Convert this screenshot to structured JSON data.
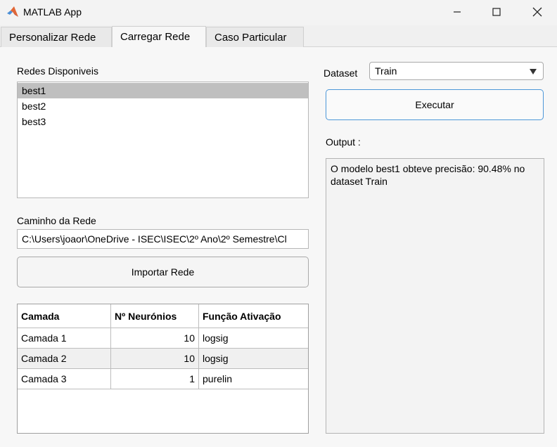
{
  "window": {
    "title": "MATLAB App"
  },
  "tabs": [
    {
      "label": "Personalizar Rede"
    },
    {
      "label": "Carregar Rede"
    },
    {
      "label": "Caso Particular"
    }
  ],
  "left": {
    "networks_label": "Redes Disponiveis",
    "networks": [
      {
        "label": "best1"
      },
      {
        "label": "best2"
      },
      {
        "label": "best3"
      }
    ],
    "path_label": "Caminho da Rede",
    "path_value": "C:\\Users\\joaor\\OneDrive - ISEC\\ISEC\\2º Ano\\2º Semestre\\Cl",
    "import_button": "Importar Rede",
    "table": {
      "headers": [
        "Camada",
        "Nº Neurónios",
        "Função Ativação"
      ],
      "rows": [
        [
          "Camada 1",
          "10",
          "logsig"
        ],
        [
          "Camada 2",
          "10",
          "logsig"
        ],
        [
          "Camada 3",
          "1",
          "purelin"
        ]
      ]
    }
  },
  "right": {
    "dataset_label": "Dataset",
    "dataset_value": "Train",
    "execute_button": "Executar",
    "output_label": "Output :",
    "output_text": "O modelo best1 obteve precisão: 90.48% no dataset Train"
  },
  "icons": {
    "app": "matlab-membrane-icon",
    "minimize": "minimize-icon",
    "maximize": "maximize-icon",
    "close": "close-icon",
    "dropdown": "chevron-down-icon"
  },
  "colors": {
    "accent_border": "#4c97d8",
    "selection": "#bfbfbf",
    "matlab_orange": "#e16737"
  }
}
